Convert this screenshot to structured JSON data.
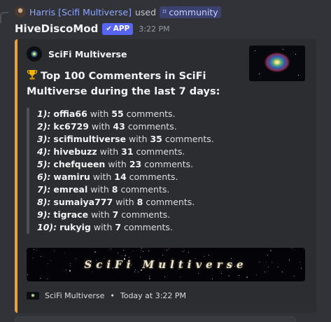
{
  "reply": {
    "user": "Harris [Scifi Multiverse]",
    "used_text": "used",
    "command": "community"
  },
  "header": {
    "bot_name": "HiveDiscoMod",
    "badge": "APP",
    "time": "3:22 PM"
  },
  "embed": {
    "accent_color": "#e6a23c",
    "author": "SciFi Multiverse",
    "title_emoji": "trophy-icon",
    "title": "Top 100 Commenters in SciFi Multiverse during the last 7 days:",
    "entries": [
      {
        "rank": "1):",
        "user": "offia66",
        "with": "with",
        "count": "55",
        "suffix": "comments."
      },
      {
        "rank": "2):",
        "user": "kc6729",
        "with": "with",
        "count": "43",
        "suffix": "comments."
      },
      {
        "rank": "3):",
        "user": "scifimultiverse",
        "with": "with",
        "count": "35",
        "suffix": "comments."
      },
      {
        "rank": "4):",
        "user": "hivebuzz",
        "with": "with",
        "count": "31",
        "suffix": "comments."
      },
      {
        "rank": "5):",
        "user": "chefqueen",
        "with": "with",
        "count": "23",
        "suffix": "comments."
      },
      {
        "rank": "6):",
        "user": "wamiru",
        "with": "with",
        "count": "14",
        "suffix": "comments."
      },
      {
        "rank": "7):",
        "user": "emreal",
        "with": "with",
        "count": "8",
        "suffix": "comments."
      },
      {
        "rank": "8):",
        "user": "sumaiya777",
        "with": "with",
        "count": "8",
        "suffix": "comments."
      },
      {
        "rank": "9):",
        "user": "tigrace",
        "with": "with",
        "count": "7",
        "suffix": "comments."
      },
      {
        "rank": "10):",
        "user": "rukyig",
        "with": "with",
        "count": "7",
        "suffix": "comments."
      }
    ],
    "banner_text": "SciFi Multiverse",
    "footer_name": "SciFi Multiverse",
    "footer_sep": "•",
    "footer_time": "Today at 3:22 PM"
  }
}
